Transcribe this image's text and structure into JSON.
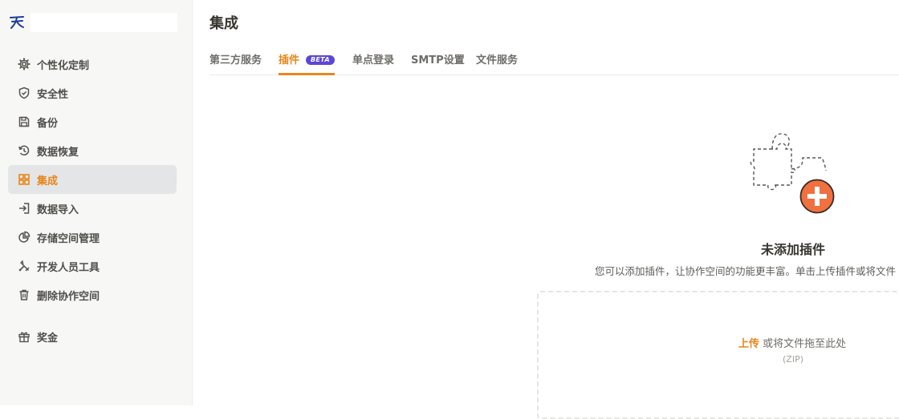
{
  "sidebar": {
    "items": [
      {
        "label": "个性化定制",
        "icon": "gear-icon"
      },
      {
        "label": "安全性",
        "icon": "shield-icon"
      },
      {
        "label": "备份",
        "icon": "save-icon"
      },
      {
        "label": "数据恢复",
        "icon": "history-icon"
      },
      {
        "label": "集成",
        "icon": "grid-icon",
        "active": true
      },
      {
        "label": "数据导入",
        "icon": "import-icon"
      },
      {
        "label": "存储空间管理",
        "icon": "pie-chart-icon"
      },
      {
        "label": "开发人员工具",
        "icon": "developer-tools-icon"
      },
      {
        "label": "删除协作空间",
        "icon": "trash-icon"
      }
    ],
    "bonus": {
      "label": "奖金",
      "icon": "gift-icon"
    }
  },
  "main": {
    "title": "集成",
    "tabs": [
      {
        "label": "第三方服务"
      },
      {
        "label": "插件",
        "badge": "BETA",
        "active": true
      },
      {
        "label": "单点登录"
      },
      {
        "label": "SMTP设置"
      },
      {
        "label": "文件服务"
      }
    ],
    "empty_state": {
      "title": "未添加插件",
      "description": "您可以添加插件，让协作空间的功能更丰富。单击上传插件或将文件",
      "upload_link": "上传",
      "upload_text": "或将文件拖至此处",
      "file_type": "(ZIP)"
    }
  },
  "colors": {
    "accent": "#e8861a",
    "beta_badge": "#5b47d6",
    "sidebar_bg": "#f7f7f5",
    "active_bg": "#e4e5e6",
    "plus_badge": "#f0703f"
  }
}
